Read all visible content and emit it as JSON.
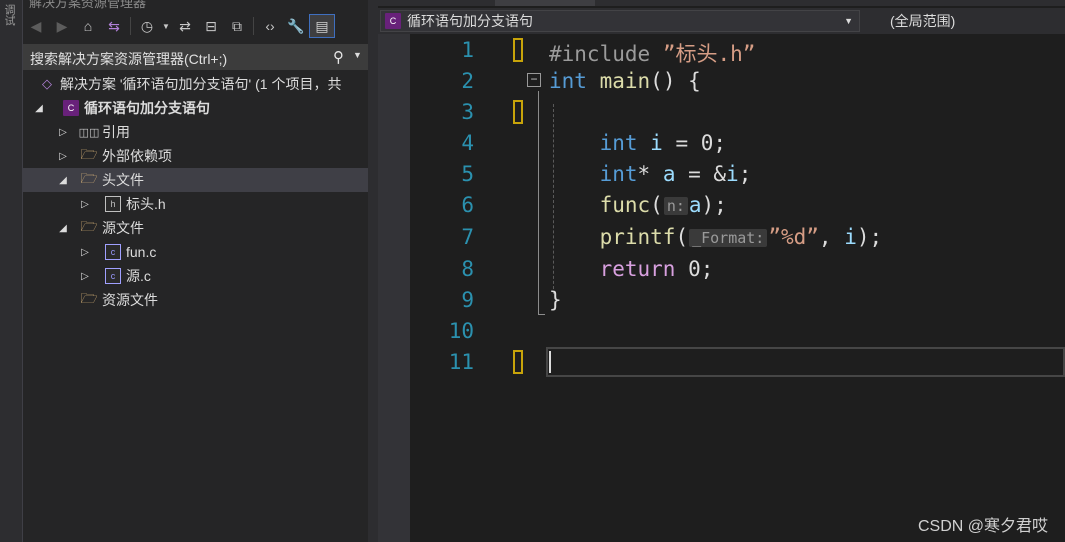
{
  "sidebar_strip": {
    "tab_label": "调试"
  },
  "explorer": {
    "title": "解决方案资源管理器",
    "toolbar_icons": [
      "back-icon",
      "forward-icon",
      "home-icon",
      "vs-switch-icon",
      "history-icon",
      "dropdown-icon",
      "sync-icon",
      "collapse-all-icon",
      "copy-view-icon",
      "code-view-icon",
      "properties-wrench-icon",
      "preview-icon"
    ],
    "search_placeholder": "搜索解决方案资源管理器(Ctrl+;)",
    "tree": [
      {
        "label": "解决方案 '循环语句加分支语句' (1 个项目，共",
        "icon": "solution-icon",
        "arrow": ""
      },
      {
        "label": "循环语句加分支语句",
        "icon": "project-icon",
        "arrow": "◢"
      },
      {
        "label": "引用",
        "icon": "references-icon",
        "arrow": "▷"
      },
      {
        "label": "外部依赖项",
        "icon": "external-deps-icon",
        "arrow": "▷"
      },
      {
        "label": "头文件",
        "icon": "folder-icon",
        "arrow": "◢",
        "selected": true
      },
      {
        "label": "标头.h",
        "icon": "header-file-icon",
        "arrow": "▷"
      },
      {
        "label": "源文件",
        "icon": "folder-icon",
        "arrow": "◢"
      },
      {
        "label": "fun.c",
        "icon": "c-file-icon",
        "arrow": "▷"
      },
      {
        "label": "源.c",
        "icon": "c-file-icon",
        "arrow": "▷"
      },
      {
        "label": "资源文件",
        "icon": "folder-icon",
        "arrow": ""
      }
    ]
  },
  "editor": {
    "scope": "循环语句加分支语句",
    "range": "(全局范围)",
    "line_numbers": [
      "1",
      "2",
      "3",
      "4",
      "5",
      "6",
      "7",
      "8",
      "9",
      "10",
      "11"
    ],
    "code": {
      "l1_directive": "#include",
      "l1_file": "”标头.h”",
      "l2_type": "int",
      "l2_name": "main",
      "l2_rest": "() {",
      "l4_type": "int",
      "l4_var": "i",
      "l4_rest": " = 0;",
      "l5_type": "int",
      "l5_star": "* ",
      "l5_var": "a",
      "l5_eq": " = &",
      "l5_var2": "i",
      "l5_end": ";",
      "l6_fn": "func",
      "l6_open": "(",
      "l6_hint": "n:",
      "l6_arg": "a",
      "l6_close": ");",
      "l7_fn": "printf",
      "l7_open": "(",
      "l7_hint": "_Format:",
      "l7_str": "”%d”",
      "l7_comma": ", ",
      "l7_arg": "i",
      "l7_close": ");",
      "l8_kw": "return",
      "l8_rest": " 0;",
      "l9": "}"
    }
  },
  "watermark": "CSDN @寒夕君哎"
}
